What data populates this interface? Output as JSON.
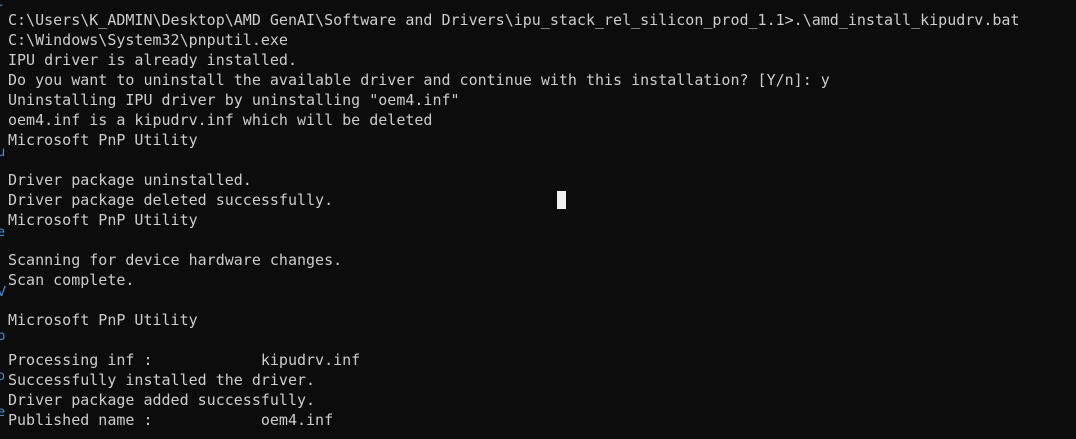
{
  "console": {
    "lines": [
      "C:\\Users\\K_ADMIN\\Desktop\\AMD GenAI\\Software and Drivers\\ipu_stack_rel_silicon_prod_1.1>.\\amd_install_kipudrv.bat",
      "C:\\Windows\\System32\\pnputil.exe",
      "IPU driver is already installed.",
      "Do you want to uninstall the available driver and continue with this installation? [Y/n]: y",
      "Uninstalling IPU driver by uninstalling \"oem4.inf\"",
      "oem4.inf is a kipudrv.inf which will be deleted",
      "Microsoft PnP Utility",
      "",
      "Driver package uninstalled.",
      "Driver package deleted successfully.",
      "Microsoft PnP Utility",
      "",
      "Scanning for device hardware changes.",
      "Scan complete.",
      "",
      "Microsoft PnP Utility",
      "",
      "Processing inf :            kipudrv.inf",
      "Successfully installed the driver.",
      "Driver package added successfully.",
      "Published name :            oem4.inf"
    ]
  },
  "background_window_fragments": [
    "r",
    "l",
    "u",
    "e",
    "V",
    "p",
    "o",
    "e"
  ],
  "colors": {
    "background": "#0c0c0c",
    "text": "#cccccc",
    "cursor": "#f2f2f2",
    "background_window_text": "#4a8fd4"
  }
}
